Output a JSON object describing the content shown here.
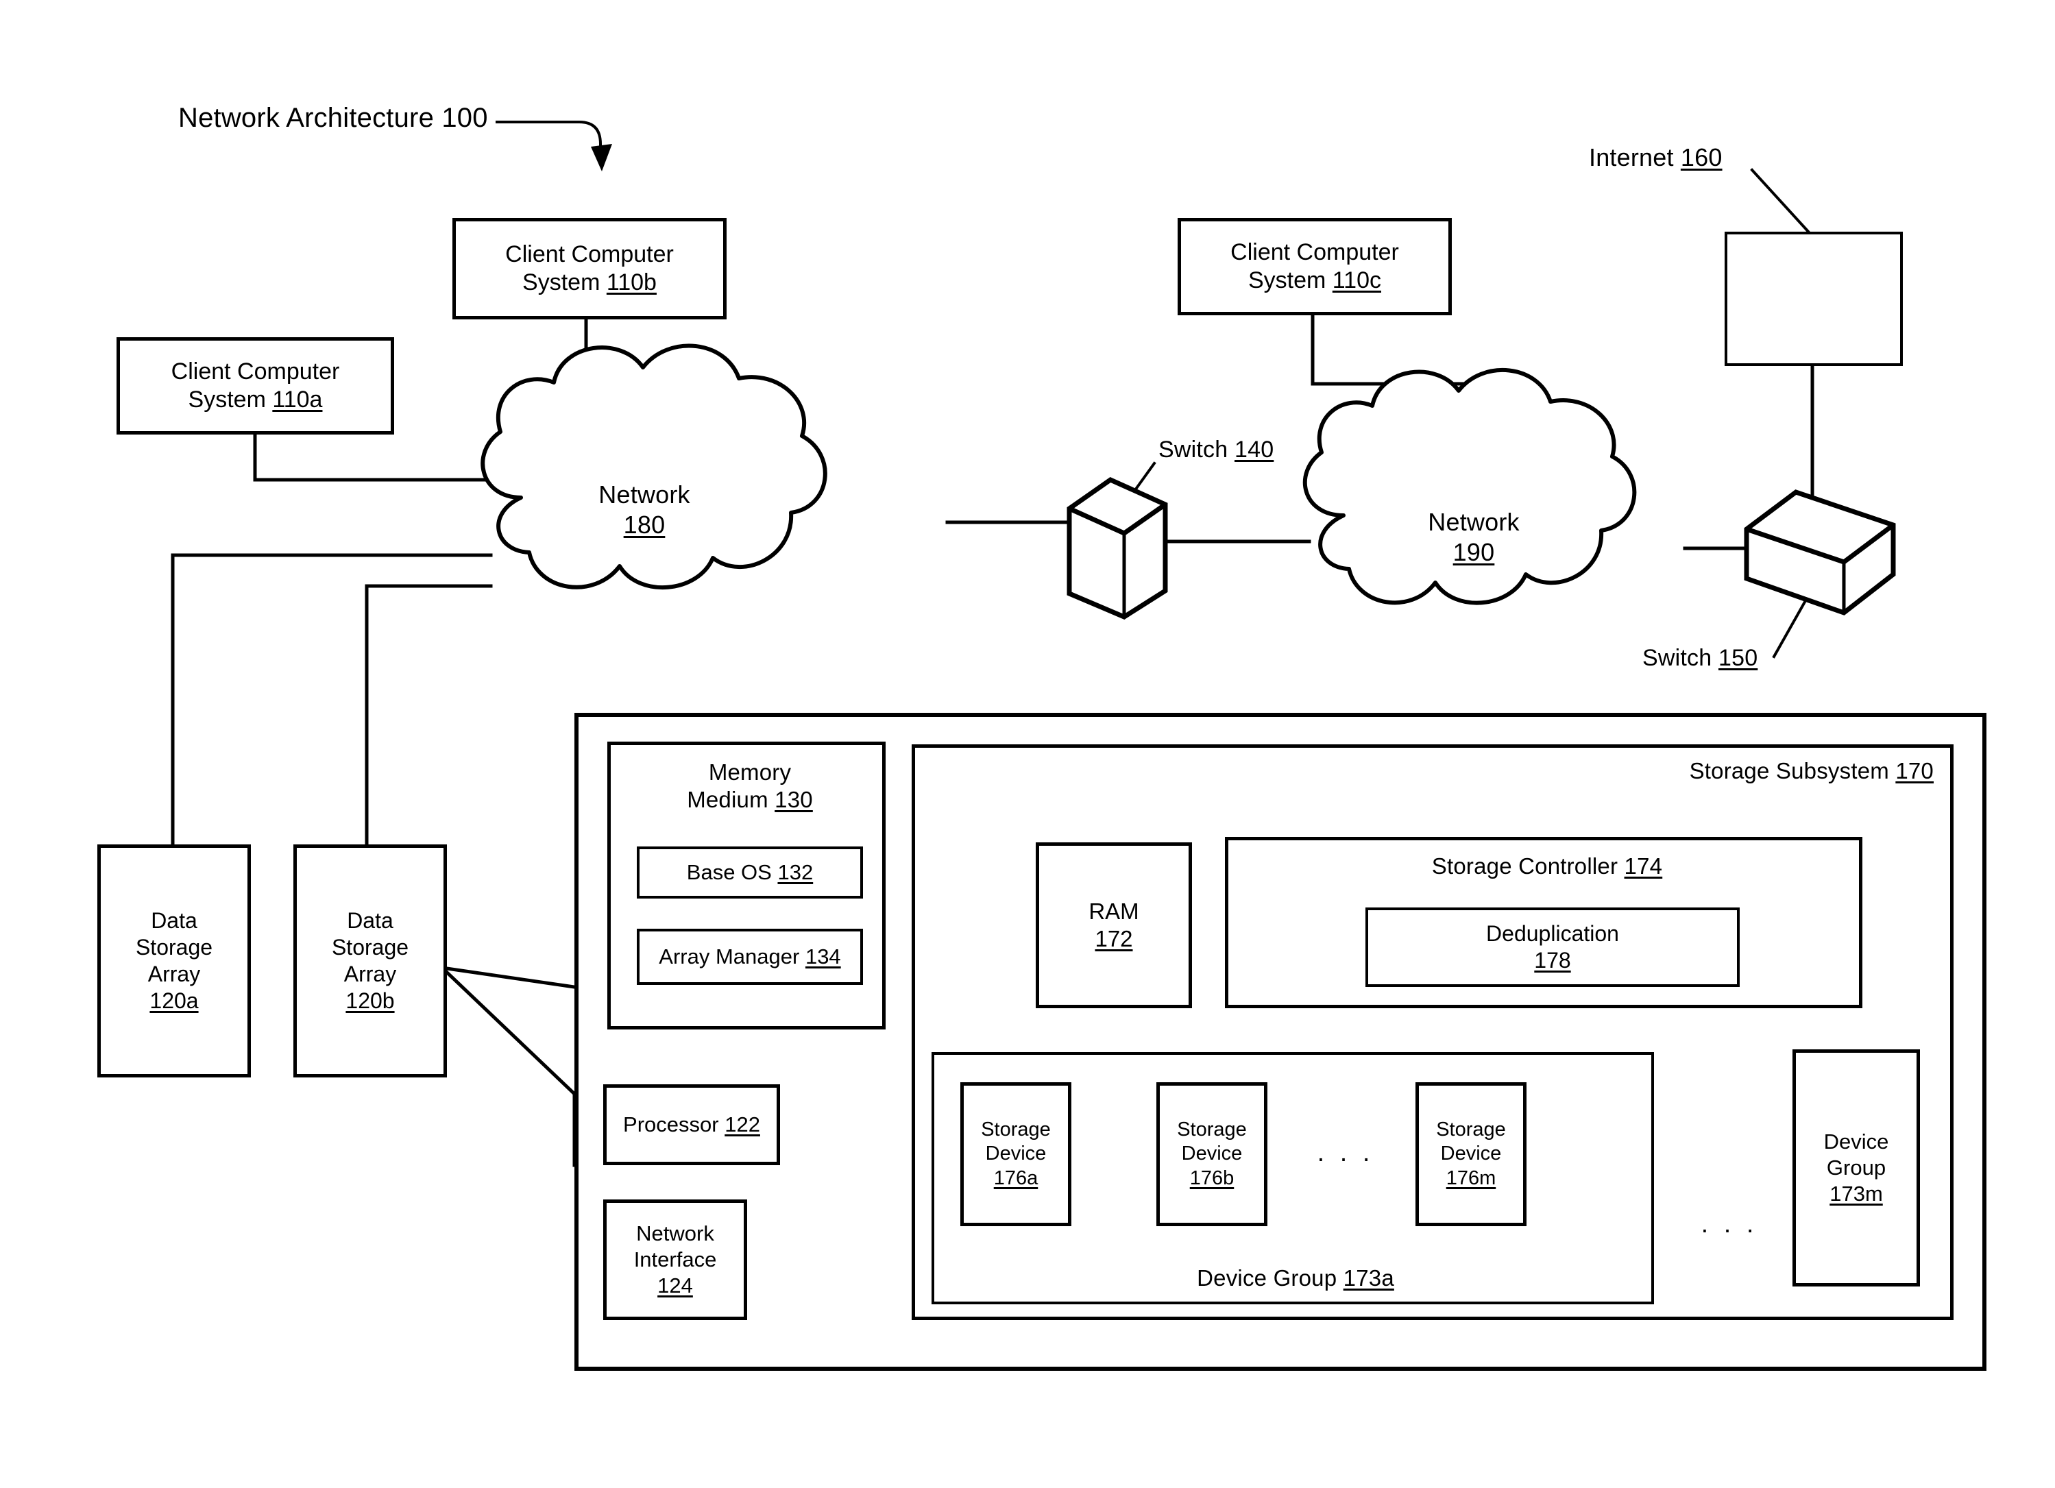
{
  "figure": {
    "title": "Network Architecture 100",
    "title_ref": "100"
  },
  "clients": [
    {
      "name": "client-110a",
      "line1": "Client Computer",
      "line2": "System",
      "ref": "110a"
    },
    {
      "name": "client-110b",
      "line1": "Client Computer",
      "line2": "System",
      "ref": "110b"
    },
    {
      "name": "client-110c",
      "line1": "Client Computer",
      "line2": "System",
      "ref": "110c"
    }
  ],
  "networks": [
    {
      "name": "network-180",
      "label": "Network",
      "ref": "180"
    },
    {
      "name": "network-190",
      "label": "Network",
      "ref": "190"
    }
  ],
  "switches": [
    {
      "name": "switch-140",
      "label": "Switch",
      "ref": "140"
    },
    {
      "name": "switch-150",
      "label": "Switch",
      "ref": "150"
    }
  ],
  "internet": {
    "label": "Internet",
    "ref": "160"
  },
  "data_storage_arrays": [
    {
      "name": "array-120a",
      "line1": "Data",
      "line2": "Storage",
      "line3": "Array",
      "ref": "120a"
    },
    {
      "name": "array-120b",
      "line1": "Data",
      "line2": "Storage",
      "line3": "Array",
      "ref": "120b"
    }
  ],
  "array_detail": {
    "memory_medium": {
      "line1": "Memory",
      "line2": "Medium",
      "ref": "130",
      "children": [
        {
          "name": "base-os",
          "label": "Base OS",
          "ref": "132"
        },
        {
          "name": "array-manager",
          "label": "Array Manager",
          "ref": "134"
        }
      ]
    },
    "processor": {
      "label": "Processor",
      "ref": "122"
    },
    "network_interface": {
      "line1": "Network",
      "line2": "Interface",
      "ref": "124"
    }
  },
  "storage_subsystem": {
    "label": "Storage Subsystem",
    "ref": "170",
    "ram": {
      "label": "RAM",
      "ref": "172"
    },
    "storage_controller": {
      "label": "Storage Controller",
      "ref": "174",
      "deduplication": {
        "label": "Deduplication",
        "ref": "178"
      }
    },
    "device_group_a": {
      "label": "Device Group",
      "ref": "173a",
      "ellipsis": ". . .",
      "storage_devices": [
        {
          "name": "storage-device-176a",
          "line1": "Storage",
          "line2": "Device",
          "ref": "176a"
        },
        {
          "name": "storage-device-176b",
          "line1": "Storage",
          "line2": "Device",
          "ref": "176b"
        },
        {
          "name": "storage-device-176m",
          "line1": "Storage",
          "line2": "Device",
          "ref": "176m"
        }
      ]
    },
    "group_ellipsis": ". . .",
    "device_group_m": {
      "line1": "Device",
      "line2": "Group",
      "ref": "173m"
    }
  },
  "colors": {
    "ink": "#000000",
    "paper": "#ffffff"
  }
}
